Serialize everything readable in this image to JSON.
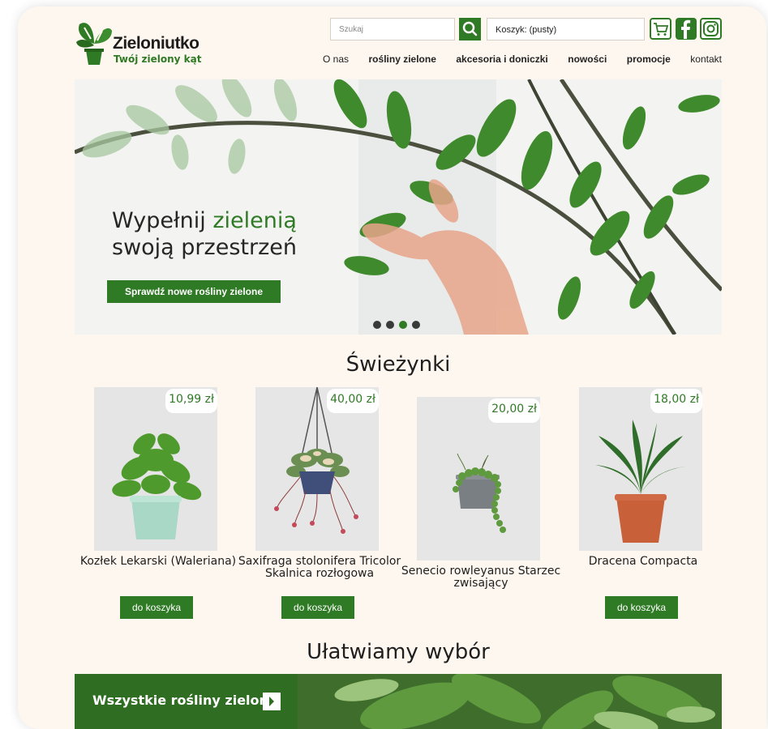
{
  "header": {
    "logo_name": "Zieloniutko",
    "logo_tagline": "Twój zielony kąt",
    "search_placeholder": "Szukaj",
    "cart_label": "Koszyk: (pusty)"
  },
  "nav": [
    "O nas",
    "rośliny zielone",
    "akcesoria i doniczki",
    "nowości",
    "promocje",
    "kontakt"
  ],
  "hero": {
    "title_part1": "Wypełnij ",
    "title_highlight": "zielenią",
    "title_part2": "swoją przestrzeń",
    "button": "Sprawdź nowe rośliny zielone",
    "slides_active": 3
  },
  "new_section": {
    "title": "Świeżynki",
    "products": [
      {
        "name": "Kozłek Lekarski (Waleriana)",
        "price": "10,99 zł",
        "button": "do koszyka"
      },
      {
        "name": "Saxifraga stolonifera Tricolor Skalnica rozłogowa",
        "price": "40,00 zł",
        "button": "do koszyka"
      },
      {
        "name": "Senecio rowleyanus Starzec zwisający",
        "price": "20,00 zł",
        "button": ""
      },
      {
        "name": "Dracena Compacta",
        "price": "18,00 zł",
        "button": "do koszyka"
      }
    ]
  },
  "choose_section": {
    "title": "Ułatwiamy wybór",
    "banner": "Wszystkie rośliny zielone"
  },
  "colors": {
    "accent": "#2f7a24",
    "background": "#fdf7ef"
  }
}
